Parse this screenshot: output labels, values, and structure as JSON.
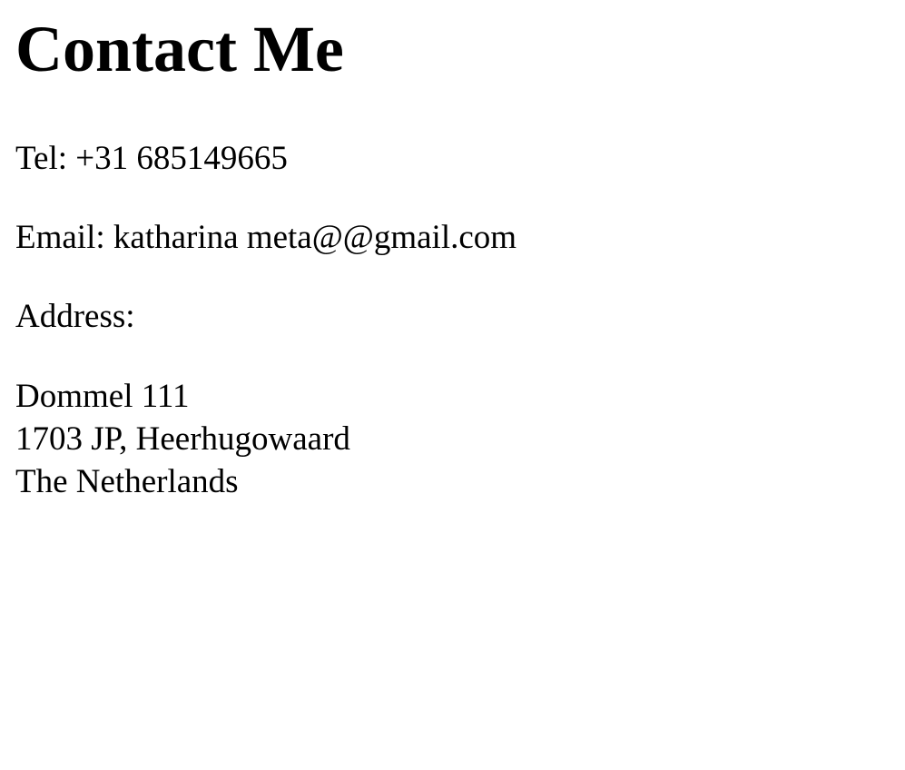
{
  "page": {
    "title": "Contact Me"
  },
  "contact": {
    "tel": "Tel: +31 685149665",
    "email": "Email: katharina meta@@gmail.com",
    "address_label": "Address:",
    "address_lines": [
      "Dommel 111",
      "1703 JP, Heerhugowaard",
      "The Netherlands"
    ]
  }
}
